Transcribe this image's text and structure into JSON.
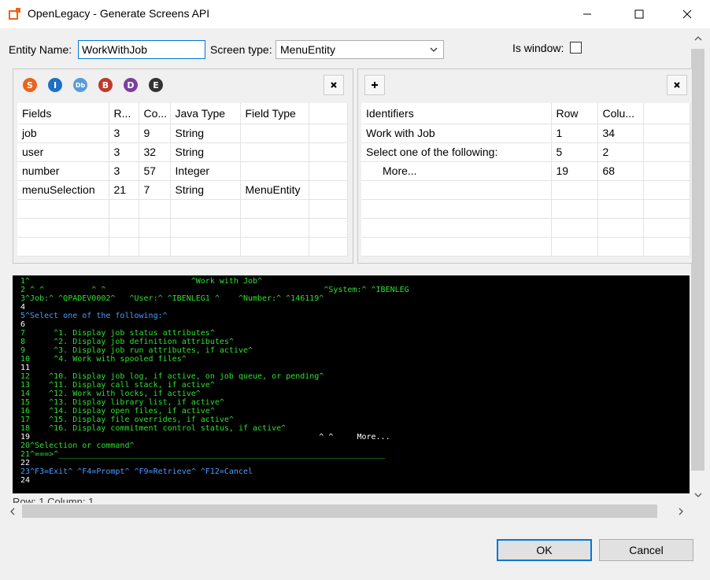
{
  "window": {
    "title": "OpenLegacy - Generate Screens API",
    "icon": "openlegacy-icon"
  },
  "form": {
    "entity_name_label": "Entity Name:",
    "entity_name_value": "WorkWithJob",
    "screen_type_label": "Screen type:",
    "screen_type_value": "MenuEntity",
    "is_window_label": "Is window:",
    "is_window_checked": false
  },
  "fields_panel": {
    "toolbar_icons": [
      {
        "letter": "S",
        "color": "#e8651e",
        "name": "string-field-icon"
      },
      {
        "letter": "I",
        "color": "#1f6fc6",
        "name": "integer-field-icon"
      },
      {
        "letter": "Db",
        "color": "#5b9bd5",
        "name": "db-field-icon"
      },
      {
        "letter": "B",
        "color": "#c0392b",
        "name": "boolean-field-icon"
      },
      {
        "letter": "D",
        "color": "#7b3fa0",
        "name": "date-field-icon"
      },
      {
        "letter": "E",
        "color": "#333333",
        "name": "enum-field-icon"
      }
    ],
    "remove_label": "×",
    "columns": [
      "Fields",
      "R...",
      "Co...",
      "Java Type",
      "Field Type"
    ],
    "rows": [
      [
        "job",
        "3",
        "9",
        "String",
        ""
      ],
      [
        "user",
        "3",
        "32",
        "String",
        ""
      ],
      [
        "number",
        "3",
        "57",
        "Integer",
        ""
      ],
      [
        "menuSelection",
        "21",
        "7",
        "String",
        "MenuEntity"
      ]
    ]
  },
  "identifiers_panel": {
    "add_label": "+",
    "remove_label": "×",
    "columns": [
      "Identifiers",
      "Row",
      "Colu..."
    ],
    "rows": [
      [
        "Work with Job",
        "1",
        "34"
      ],
      [
        "Select one of the following:",
        "5",
        "2"
      ],
      [
        "More...",
        "19",
        "68"
      ]
    ]
  },
  "terminal": {
    "lines": [
      {
        "text": "1^                                  ^Work with Job^",
        "color": "g"
      },
      {
        "text": "2 ^ ^          ^ ^                                              ^System:^ ^IBENLEG",
        "color": "g"
      },
      {
        "text": "3^Job:^ ^QPADEV0002^   ^User:^ ^IBENLEG1 ^    ^Number:^ ^146119^",
        "color": "g"
      },
      {
        "text": "4",
        "color": "w"
      },
      {
        "text": "5^Select one of the following:^",
        "color": "b"
      },
      {
        "text": "6",
        "color": "w"
      },
      {
        "text": "7      ^1. Display job status attributes^",
        "color": "g"
      },
      {
        "text": "8      ^2. Display job definition attributes^",
        "color": "g"
      },
      {
        "text": "9      ^3. Display job run attributes, if active^",
        "color": "g"
      },
      {
        "text": "10     ^4. Work with spooled files^",
        "color": "g"
      },
      {
        "text": "11",
        "color": "w"
      },
      {
        "text": "12    ^10. Display job log, if active, on job queue, or pending^",
        "color": "g"
      },
      {
        "text": "13    ^11. Display call stack, if active^",
        "color": "g"
      },
      {
        "text": "14    ^12. Work with locks, if active^",
        "color": "g"
      },
      {
        "text": "15    ^13. Display library list, if active^",
        "color": "g"
      },
      {
        "text": "16    ^14. Display open files, if active^",
        "color": "g"
      },
      {
        "text": "17    ^15. Display file overrides, if active^",
        "color": "g"
      },
      {
        "text": "18    ^16. Display commitment control status, if active^",
        "color": "g"
      },
      {
        "text": "19                                                             ^ ^     More...",
        "color": "w"
      },
      {
        "text": "20^Selection or command^",
        "color": "g"
      },
      {
        "text": "21^===>^_____________________________________________________________________",
        "color": "g"
      },
      {
        "text": "22",
        "color": "w"
      },
      {
        "text": "23^F3=Exit^ ^F4=Prompt^ ^F9=Retrieve^ ^F12=Cancel",
        "color": "b"
      },
      {
        "text": "24",
        "color": "w"
      }
    ]
  },
  "status": {
    "cursor_text": "Row: 1 Column: 1"
  },
  "buttons": {
    "ok": "OK",
    "cancel": "Cancel"
  }
}
